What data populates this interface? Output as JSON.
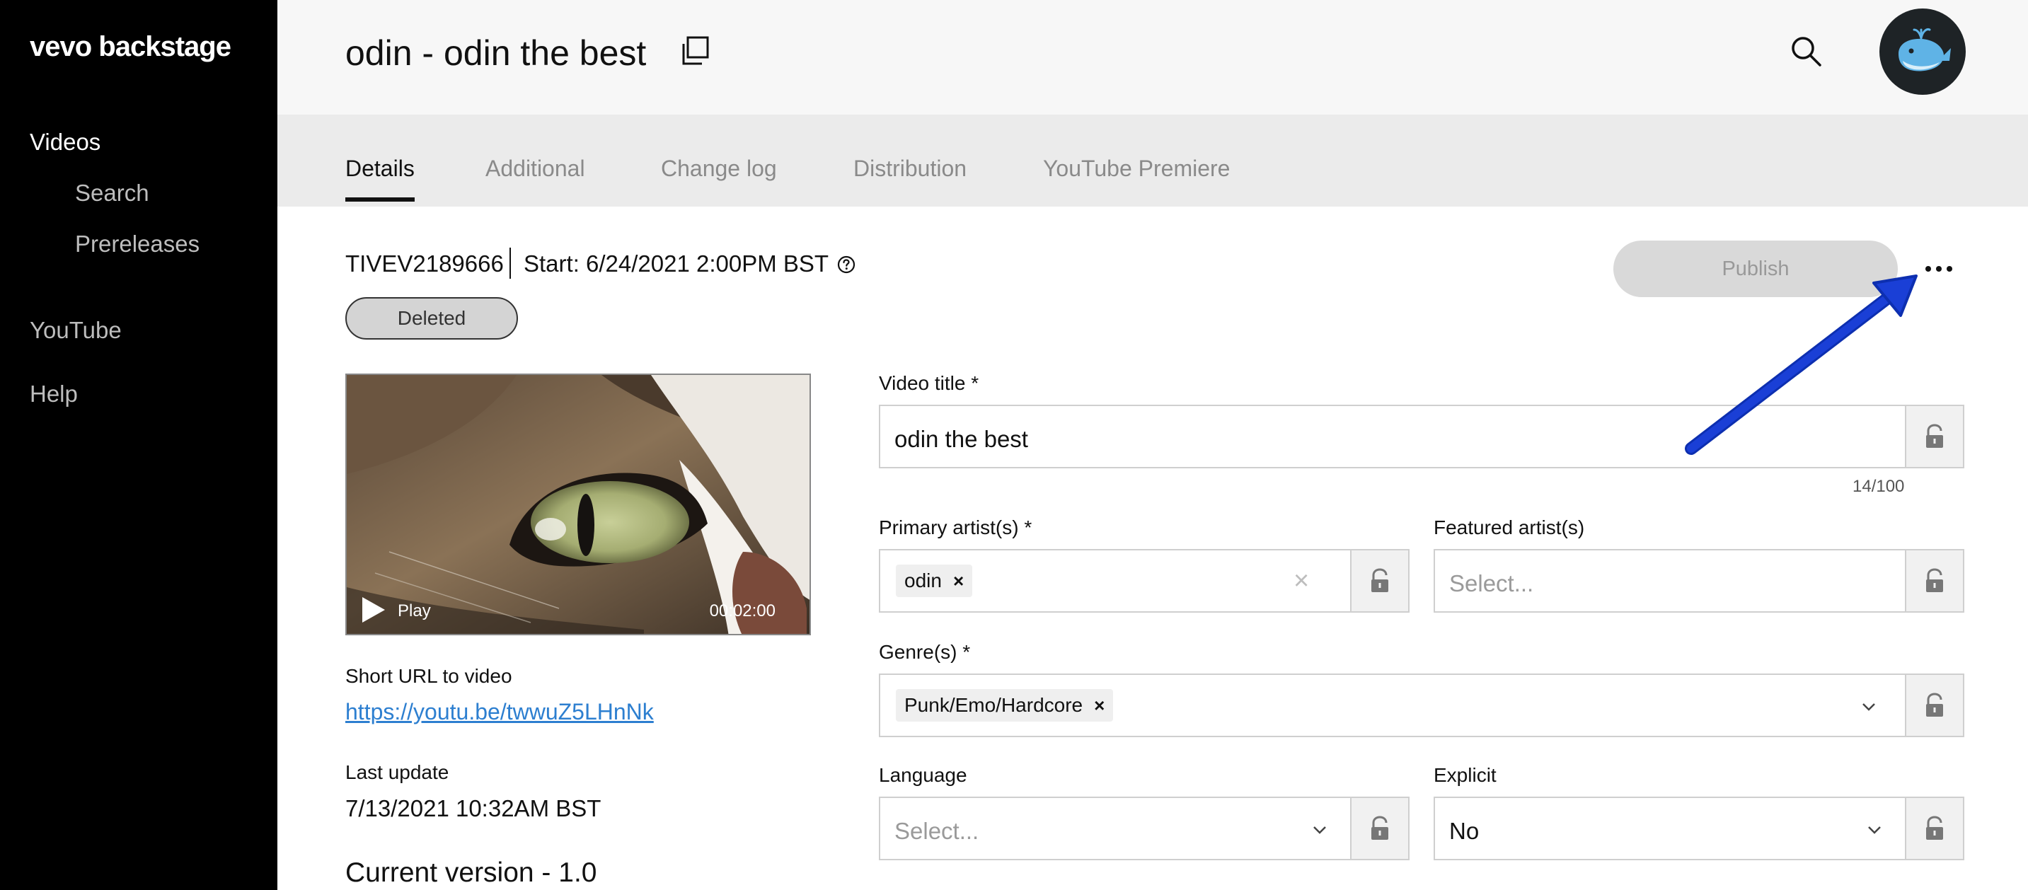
{
  "app": {
    "logo": "vevo backstage"
  },
  "sidebar": {
    "items": [
      {
        "label": "Videos"
      },
      {
        "label": "Search"
      },
      {
        "label": "Prereleases"
      },
      {
        "label": "YouTube"
      },
      {
        "label": "Help"
      }
    ]
  },
  "header": {
    "title": "odin - odin the best"
  },
  "tabs": [
    {
      "label": "Details",
      "active": true
    },
    {
      "label": "Additional"
    },
    {
      "label": "Change log"
    },
    {
      "label": "Distribution"
    },
    {
      "label": "YouTube Premiere"
    }
  ],
  "info": {
    "id": "TIVEV2189666",
    "start": "Start: 6/24/2021 2:00PM BST",
    "status": "Deleted"
  },
  "actions": {
    "publish_label": "Publish"
  },
  "video": {
    "play_label": "Play",
    "duration": "00:02:00",
    "short_url_label": "Short URL to video",
    "short_url": "https://youtu.be/twwuZ5LHnNk",
    "last_update_label": "Last update",
    "last_update": "7/13/2021 10:32AM BST",
    "version": "Current version - 1.0"
  },
  "form": {
    "title_label": "Video title *",
    "title_value": "odin the best",
    "title_counter": "14/100",
    "primary_label": "Primary artist(s) *",
    "primary_chip": "odin",
    "featured_label": "Featured artist(s)",
    "featured_placeholder": "Select...",
    "genre_label": "Genre(s) *",
    "genre_chip": "Punk/Emo/Hardcore",
    "language_label": "Language",
    "language_placeholder": "Select...",
    "explicit_label": "Explicit",
    "explicit_value": "No"
  },
  "colors": {
    "sidebar_bg": "#000000",
    "link": "#2d7fd0",
    "arrow": "#1a3fd6"
  }
}
